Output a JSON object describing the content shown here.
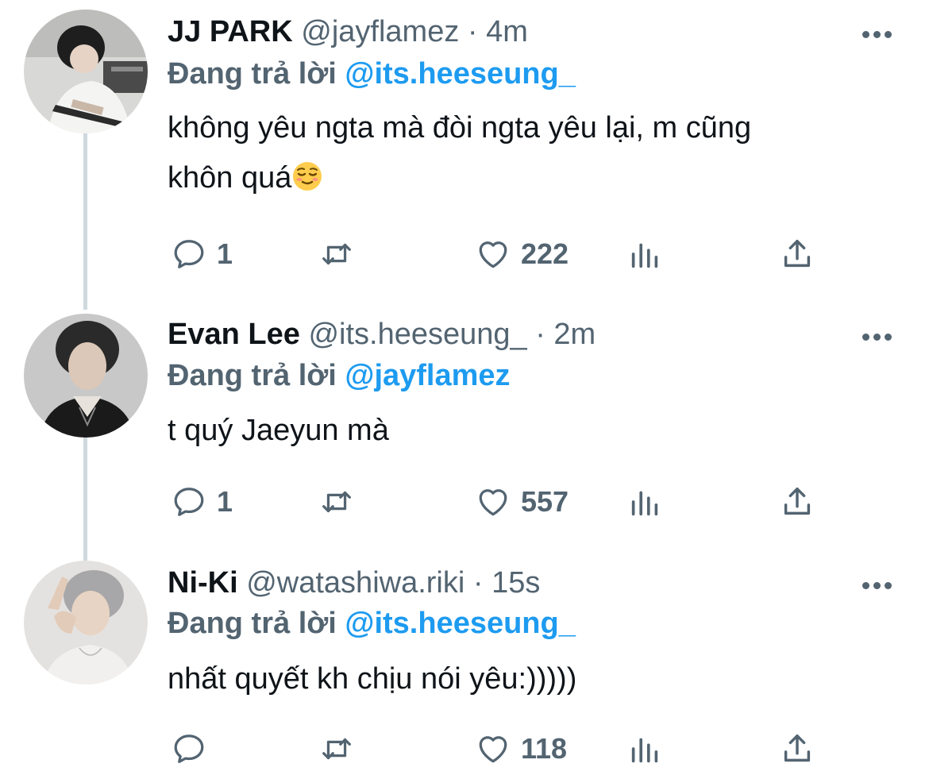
{
  "tweets": [
    {
      "name": "JJ PARK",
      "handle": "@jayflamez",
      "dot": "·",
      "time": "4m",
      "replying_label": "Đang trả lời",
      "replying_to": "@its.heeseung_",
      "text_lines": [
        "không yêu ngta mà đòi ngta yêu lại, m cũng",
        "khôn quá"
      ],
      "emoji": "relieved-face-emoji",
      "reply_count": "1",
      "retweet_count": "",
      "like_count": "222"
    },
    {
      "name": "Evan Lee",
      "handle": "@its.heeseung_",
      "dot": "·",
      "time": "2m",
      "replying_label": "Đang trả lời",
      "replying_to": "@jayflamez",
      "text_lines": [
        "t quý Jaeyun mà"
      ],
      "reply_count": "1",
      "retweet_count": "",
      "like_count": "557"
    },
    {
      "name": "Ni-Ki",
      "handle": "@watashiwa.riki",
      "dot": "·",
      "time": "15s",
      "replying_label": "Đang trả lời",
      "replying_to": "@its.heeseung_",
      "text_lines": [
        "nhất quyết kh chịu nói yêu:)))))"
      ],
      "reply_count": "",
      "retweet_count": "",
      "like_count": "118"
    }
  ],
  "icons": {
    "reply": "reply-icon",
    "retweet": "retweet-icon",
    "like": "heart-icon",
    "views": "views-icon",
    "share": "share-icon",
    "more": "more-icon"
  },
  "colors": {
    "accent": "#1d9bf0",
    "secondary_text": "#536471",
    "primary_text": "#0f1419",
    "thread_line": "#cfd9de"
  }
}
